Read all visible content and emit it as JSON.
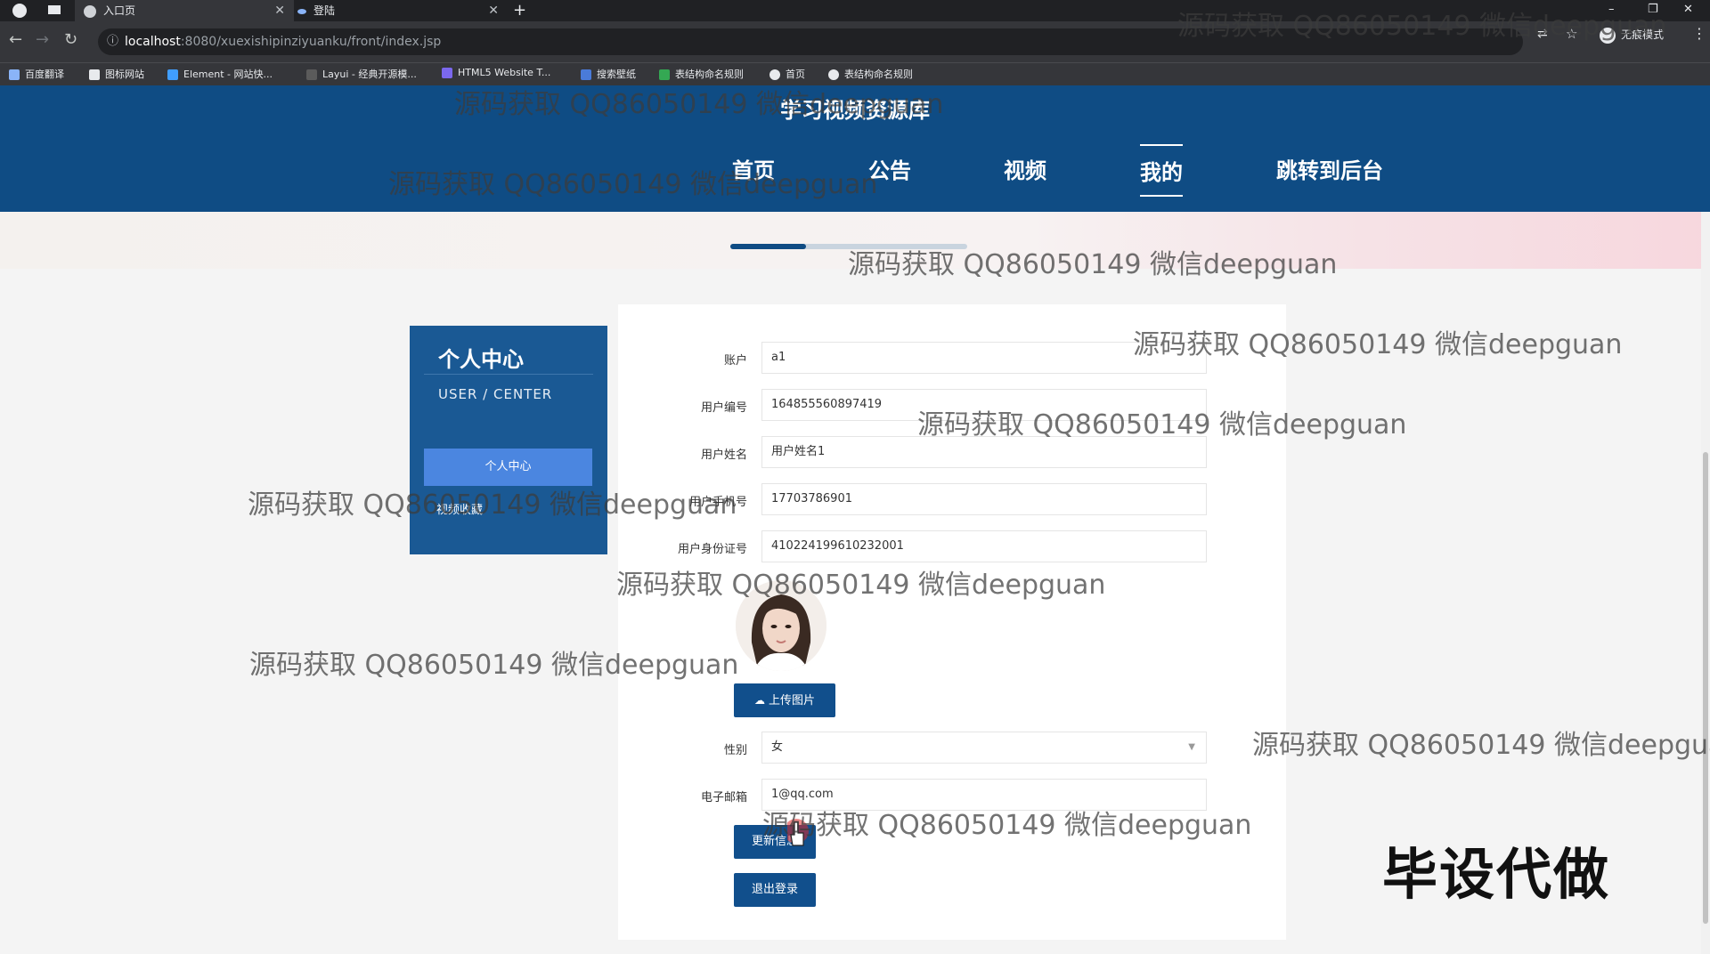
{
  "browser": {
    "tabs": [
      {
        "label": "入口页",
        "active": true
      },
      {
        "label": "登陆",
        "active": false
      }
    ],
    "url_host": "localhost",
    "url_path": ":8080/xuexishipinziyuanku/front/index.jsp",
    "incognito_label": "无痕模式",
    "bookmarks": [
      "百度翻译",
      "图标网站",
      "Element - 网站快...",
      "Layui - 经典开源模...",
      "HTML5 Website T...",
      "搜索壁纸",
      "表结构命名规则",
      "首页",
      "表结构命名规则"
    ]
  },
  "site": {
    "title": "学习视频资源库",
    "nav": [
      "首页",
      "公告",
      "视频",
      "我的",
      "跳转到后台"
    ],
    "active_nav": "我的",
    "accent_color": "#0f4c84"
  },
  "slider": {
    "progress": 0.32
  },
  "sidebar": {
    "title": "个人中心",
    "subtitle": "USER / CENTER",
    "button": "个人中心",
    "link": "视频收藏"
  },
  "form": {
    "account_label": "账户",
    "account_value": "a1",
    "user_no_label": "用户编号",
    "user_no_value": "164855560897419",
    "name_label": "用户姓名",
    "name_value": "用户姓名1",
    "phone_label": "用户手机号",
    "phone_value": "17703786901",
    "id_label": "用户身份证号",
    "id_value": "410224199610232001",
    "upload_label": "上传图片",
    "gender_label": "性别",
    "gender_value": "女",
    "email_label": "电子邮箱",
    "email_value": "1@qq.com",
    "update_label": "更新信息",
    "logout_label": "退出登录"
  },
  "watermark_text": "源码获取 QQ86050149 微信deepguan",
  "brand_text": "毕设代做"
}
